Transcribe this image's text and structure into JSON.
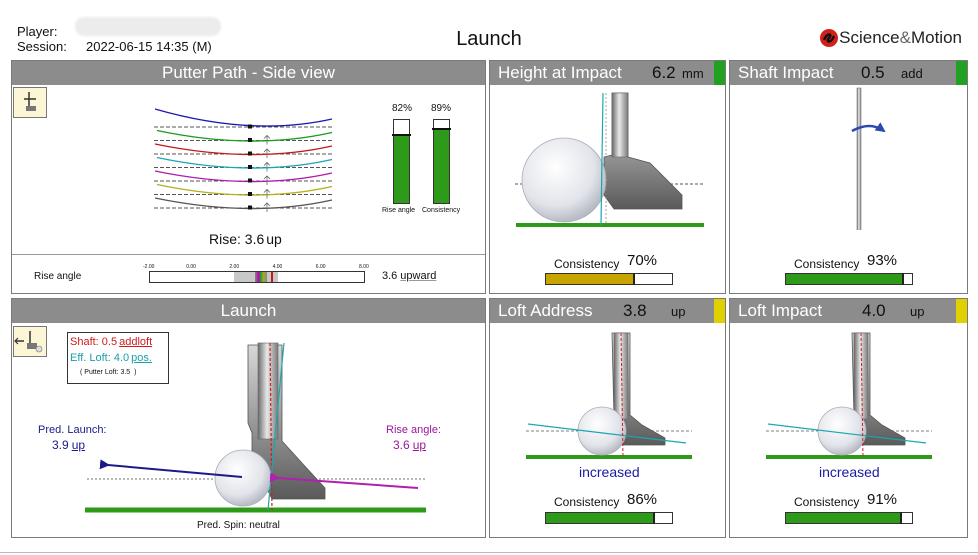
{
  "header": {
    "player_label": "Player:",
    "session_label": "Session:",
    "session_value": "2022-06-15 14:35 (M)",
    "title": "Launch",
    "brand": {
      "name_left": "Science",
      "amp": "&",
      "name_right": "Motion"
    }
  },
  "putter_path": {
    "title": "Putter Path - Side view",
    "rise_text": "Rise: 3.6",
    "rise_unit": "up",
    "bars": [
      {
        "pct_label": "82%",
        "label": "Rise angle",
        "value": 0.82
      },
      {
        "pct_label": "89%",
        "label": "Consistency",
        "value": 0.89
      }
    ],
    "scale": {
      "label": "Rise angle",
      "ticks": [
        "-2.00",
        "0.00",
        "2.00",
        "4.00",
        "6.00",
        "8.00"
      ],
      "value_text": "3.6",
      "value_unit": "upward",
      "value": 3.6
    },
    "path_colors": [
      "#1a1ab0",
      "#1a9c1a",
      "#c01a1a",
      "#1aa8b0",
      "#b01ab0",
      "#b0b01a",
      "#555555"
    ]
  },
  "height_at_impact": {
    "title": "Height at Impact",
    "value": "6.2",
    "unit": "mm",
    "indicator_color": "#22a022",
    "consistency_label": "Consistency",
    "consistency_value": "70%",
    "consistency": 0.7,
    "bar_color": "#c8a400"
  },
  "shaft_impact": {
    "title": "Shaft Impact",
    "value": "0.5",
    "unit": "add",
    "indicator_color": "#22a022",
    "consistency_label": "Consistency",
    "consistency_value": "93%",
    "consistency": 0.93,
    "bar_color": "#2e9a1a"
  },
  "launch": {
    "title": "Launch",
    "shaft_line": "Shaft: 0.5",
    "shaft_unit": "addloft",
    "eff_loft_line": "Eff. Loft: 4.0",
    "eff_loft_unit": "pos.",
    "putter_loft_line": "( Putter Loft: 3.5 ",
    "putter_loft_close": ")",
    "pred_launch_label": "Pred. Launch:",
    "pred_launch_value": "3.9",
    "pred_launch_unit": "up",
    "rise_angle_label": "Rise angle:",
    "rise_angle_value": "3.6",
    "rise_angle_unit": "up",
    "pred_spin": "Pred. Spin: neutral"
  },
  "loft_address": {
    "title": "Loft Address",
    "value": "3.8",
    "unit": "up",
    "indicator_color": "#e0d000",
    "note": "increased",
    "consistency_label": "Consistency",
    "consistency_value": "86%",
    "consistency": 0.86,
    "bar_color": "#2e9a1a"
  },
  "loft_impact": {
    "title": "Loft Impact",
    "value": "4.0",
    "unit": "up",
    "indicator_color": "#e0d000",
    "note": "increased",
    "consistency_label": "Consistency",
    "consistency_value": "91%",
    "consistency": 0.91,
    "bar_color": "#2e9a1a"
  }
}
